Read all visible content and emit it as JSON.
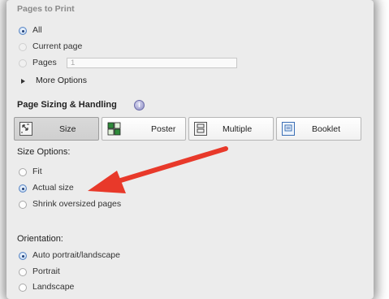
{
  "pages_to_print": {
    "heading": "Pages to Print",
    "all_label": "All",
    "current_page_label": "Current page",
    "pages_label": "Pages",
    "pages_value": "1",
    "more_options_label": "More Options"
  },
  "sizing": {
    "heading": "Page Sizing & Handling",
    "info_glyph": "i",
    "buttons": [
      {
        "label": "Size",
        "icon": "size-icon",
        "selected": true
      },
      {
        "label": "Poster",
        "icon": "poster-icon",
        "selected": false
      },
      {
        "label": "Multiple",
        "icon": "multiple-icon",
        "selected": false
      },
      {
        "label": "Booklet",
        "icon": "booklet-icon",
        "selected": false
      }
    ]
  },
  "size_options": {
    "heading": "Size Options:",
    "fit_label": "Fit",
    "actual_size_label": "Actual size",
    "shrink_label": "Shrink oversized pages",
    "selected": "Actual size"
  },
  "orientation": {
    "heading": "Orientation:",
    "auto_label": "Auto portrait/landscape",
    "portrait_label": "Portrait",
    "landscape_label": "Landscape",
    "selected": "Auto portrait/landscape"
  },
  "colors": {
    "arrow": "#e8392a",
    "panel": "#ececec",
    "radio_selected": "#5a86c4"
  }
}
